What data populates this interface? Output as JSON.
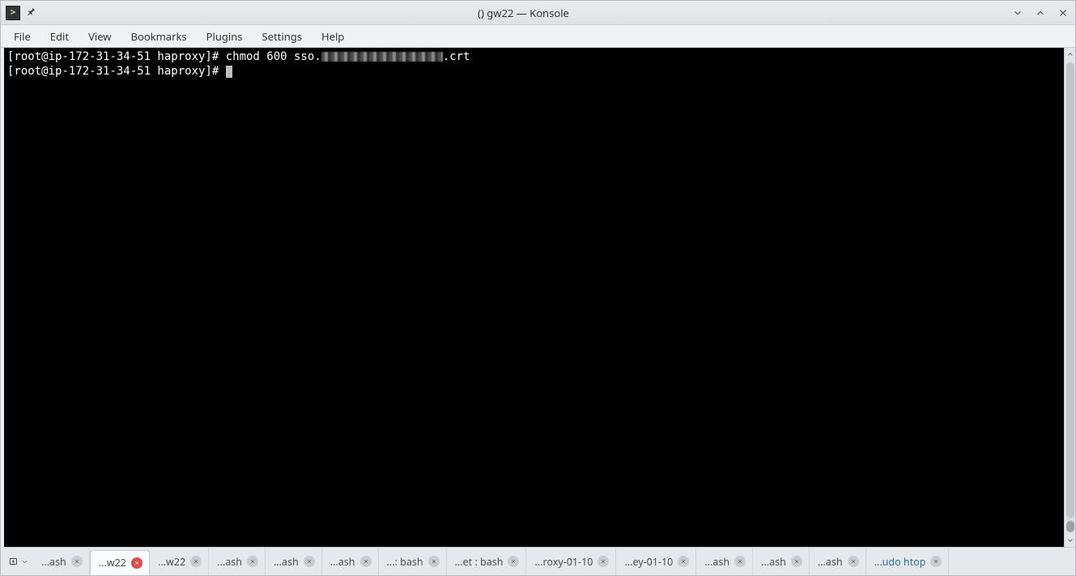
{
  "window": {
    "title": "() gw22 — Konsole"
  },
  "menubar": {
    "items": [
      "File",
      "Edit",
      "View",
      "Bookmarks",
      "Plugins",
      "Settings",
      "Help"
    ]
  },
  "terminal": {
    "line1_prompt": "[root@ip-172-31-34-51 haproxy]# ",
    "line1_cmd_pre": "chmod 600 sso.",
    "line1_cmd_post": ".crt",
    "line2_prompt": "[root@ip-172-31-34-51 haproxy]# "
  },
  "tabs": {
    "items": [
      {
        "label": "...ash",
        "active": false
      },
      {
        "label": "...w22",
        "active": true
      },
      {
        "label": "...w22",
        "active": false
      },
      {
        "label": "...ash",
        "active": false
      },
      {
        "label": "...ash",
        "active": false
      },
      {
        "label": "...ash",
        "active": false
      },
      {
        "label": "...: bash",
        "active": false
      },
      {
        "label": "...et : bash",
        "active": false
      },
      {
        "label": "...roxy-01-10",
        "active": false
      },
      {
        "label": "...ey-01-10",
        "active": false
      },
      {
        "label": "...ash",
        "active": false
      },
      {
        "label": "...ash",
        "active": false
      },
      {
        "label": "...ash",
        "active": false
      },
      {
        "label": "...udo htop",
        "active": false,
        "link": true
      }
    ]
  }
}
